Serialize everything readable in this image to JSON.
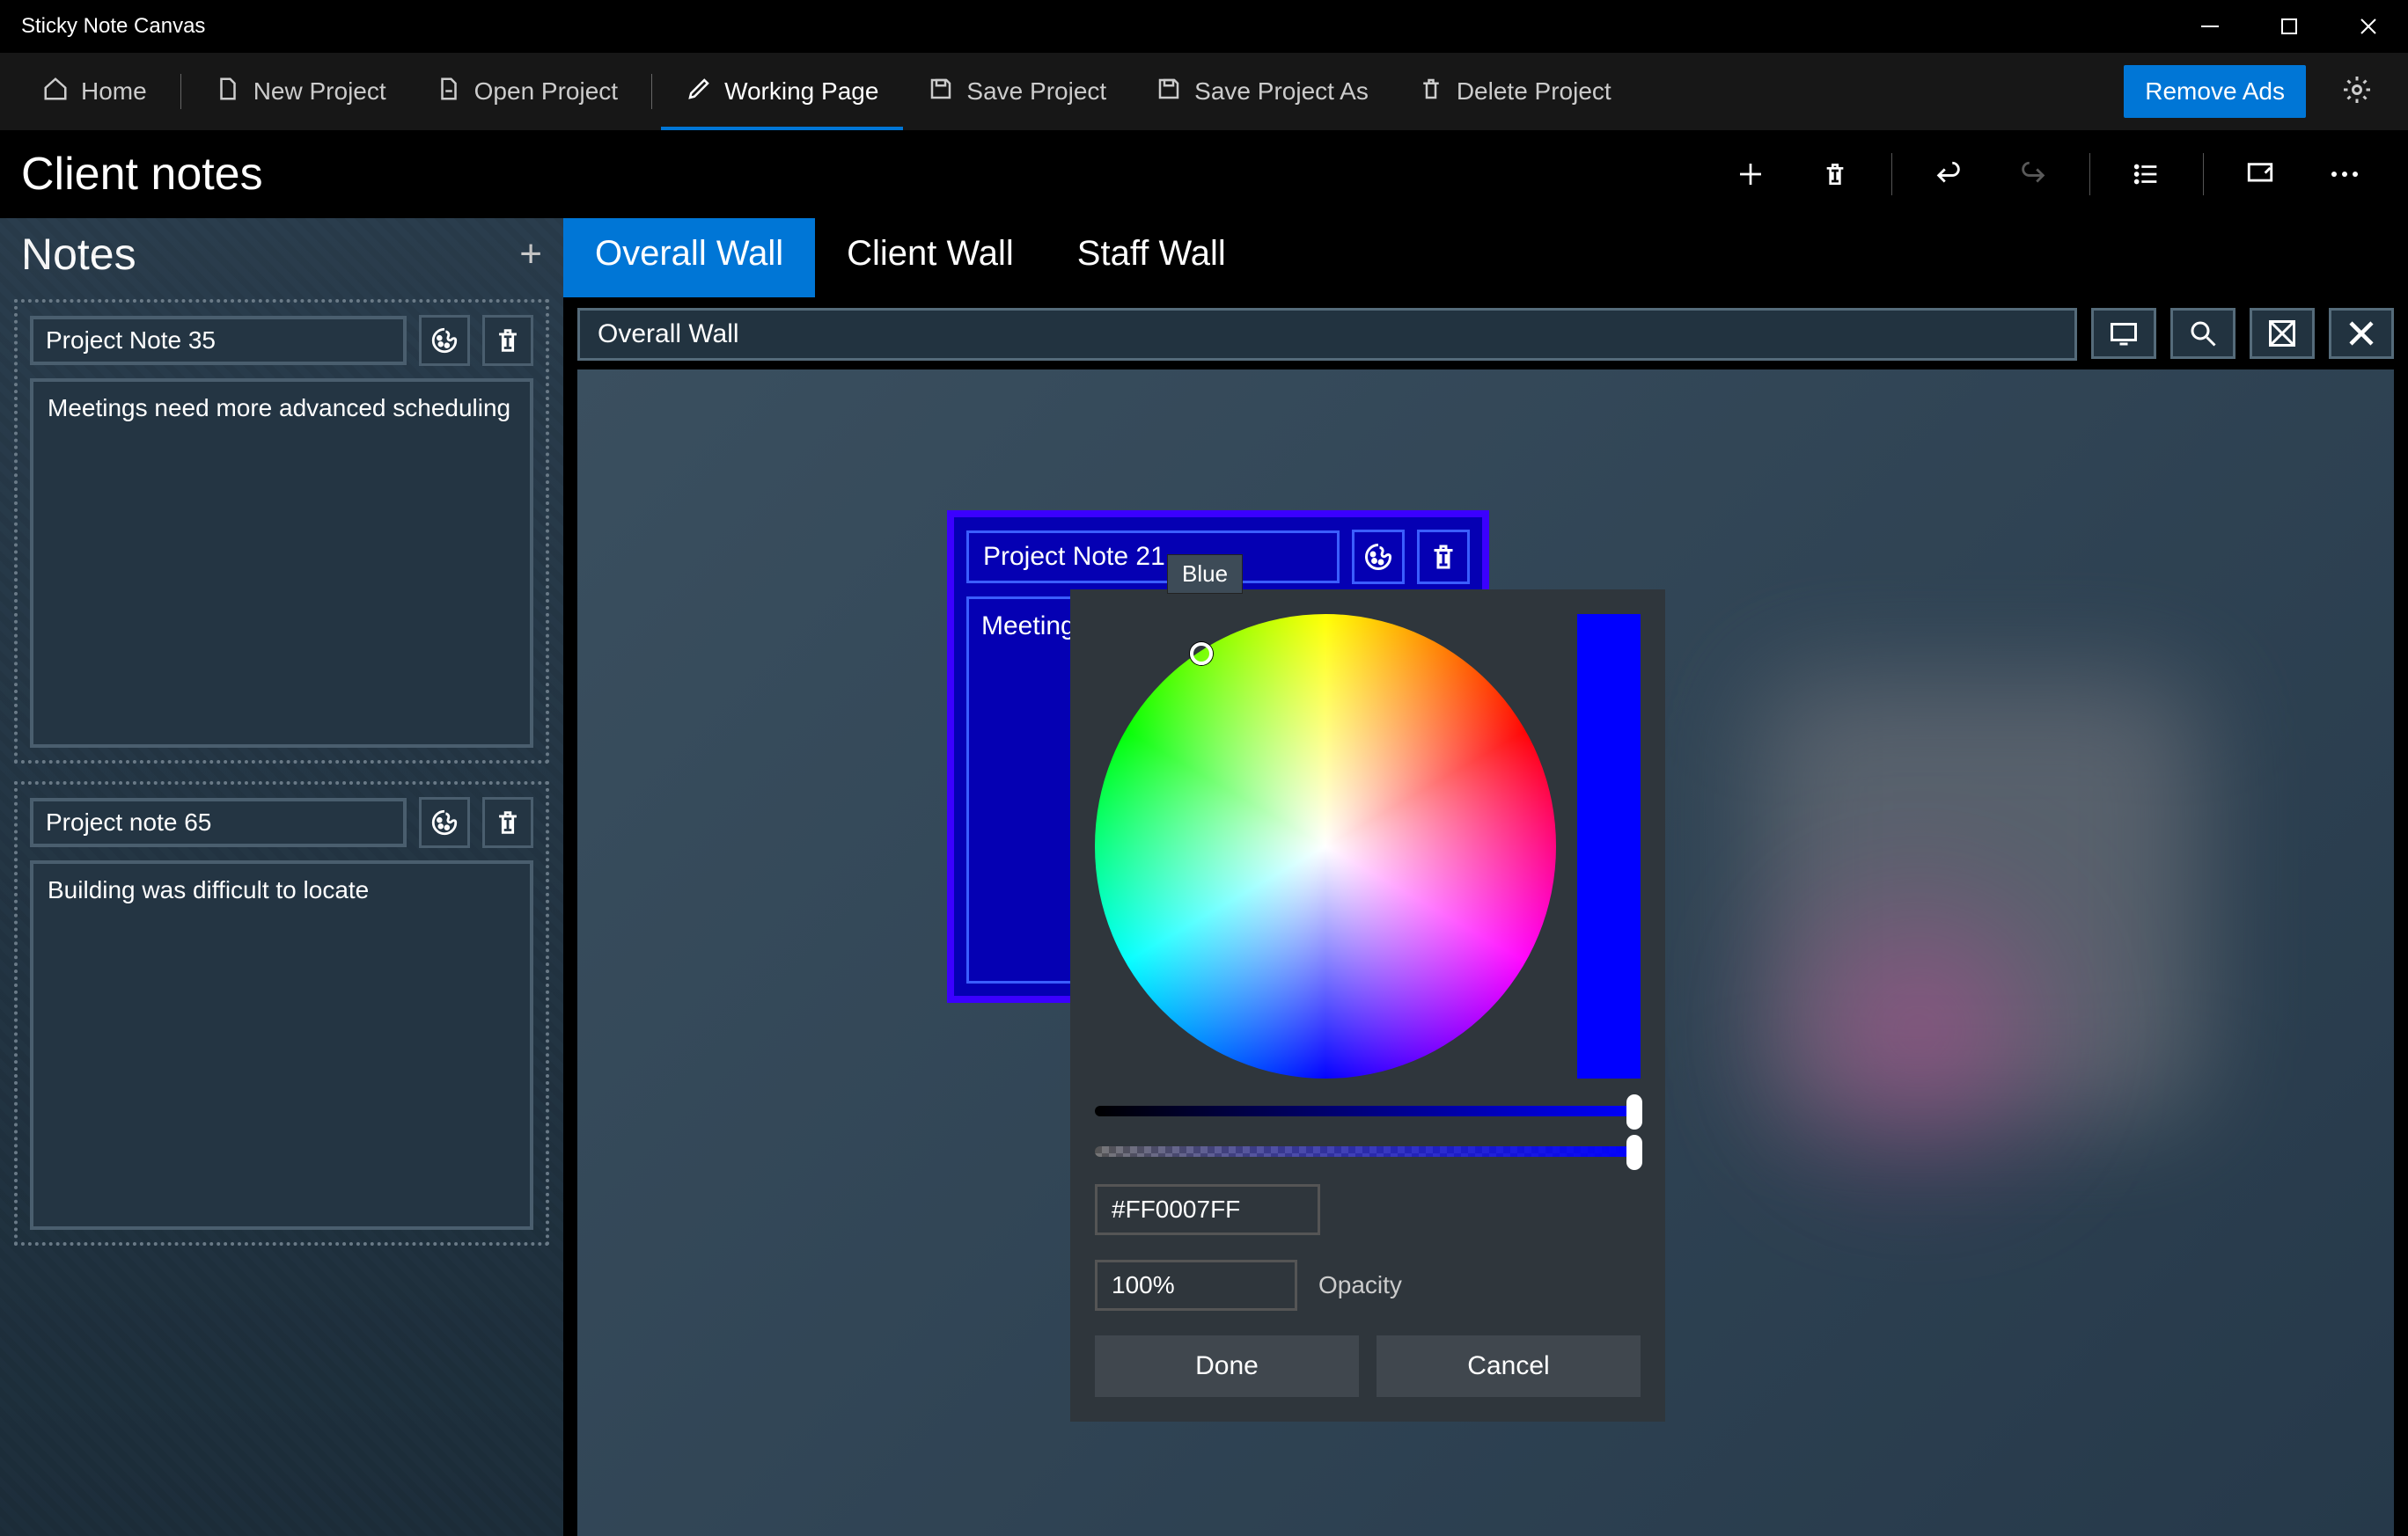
{
  "window": {
    "title": "Sticky Note Canvas"
  },
  "menu": {
    "home": "Home",
    "new_project": "New Project",
    "open_project": "Open Project",
    "working_page": "Working Page",
    "save_project": "Save Project",
    "save_project_as": "Save Project As",
    "delete_project": "Delete Project",
    "remove_ads": "Remove Ads"
  },
  "header": {
    "page_title": "Client notes"
  },
  "sidebar": {
    "title": "Notes",
    "notes": [
      {
        "title": "Project Note 35",
        "body": "Meetings need more advanced scheduling"
      },
      {
        "title": "Project note 65",
        "body": "Building was difficult to locate"
      }
    ]
  },
  "tabs": [
    "Overall Wall",
    "Client Wall",
    "Staff Wall"
  ],
  "active_tab": 0,
  "wall": {
    "name": "Overall Wall"
  },
  "canvas_note": {
    "title": "Project Note 21",
    "body": "Meeting"
  },
  "tooltip": "Blue",
  "color_picker": {
    "hex": "#FF0007FF",
    "opacity": "100%",
    "opacity_label": "Opacity",
    "done": "Done",
    "cancel": "Cancel",
    "selected_color": "#0000ff"
  }
}
